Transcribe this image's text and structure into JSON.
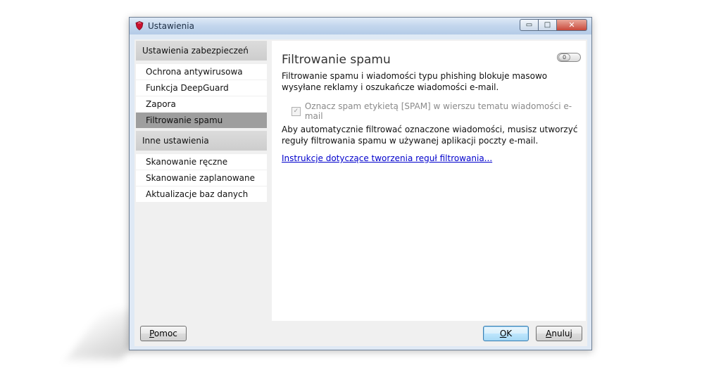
{
  "window": {
    "title": "Ustawienia"
  },
  "sidebar": {
    "sections": [
      {
        "header": "Ustawienia zabezpieczeń",
        "items": [
          {
            "label": "Ochrona antywirusowa",
            "active": false
          },
          {
            "label": "Funkcja DeepGuard",
            "active": false
          },
          {
            "label": "Zapora",
            "active": false
          },
          {
            "label": "Filtrowanie spamu",
            "active": true
          }
        ]
      },
      {
        "header": "Inne ustawienia",
        "items": [
          {
            "label": "Skanowanie ręczne",
            "active": false
          },
          {
            "label": "Skanowanie zaplanowane",
            "active": false
          },
          {
            "label": "Aktualizacje baz danych",
            "active": false
          }
        ]
      }
    ]
  },
  "main": {
    "title": "Filtrowanie spamu",
    "toggle_label": "0",
    "description": "Filtrowanie spamu i wiadomości typu phishing blokuje masowo wysyłane reklamy i oszukańcze wiadomości e-mail.",
    "checkbox_label": "Oznacz spam etykietą [SPAM] w wierszu tematu wiadomości e-mail",
    "checkbox_checked": true,
    "checkbox_mark": "✓",
    "note": "Aby automatycznie filtrować oznaczone wiadomości, musisz utworzyć reguły filtrowania spamu w używanej aplikacji poczty e-mail.",
    "link_text": "Instrukcje dotyczące tworzenia reguł filtrowania..."
  },
  "buttons": {
    "help": "Pomoc",
    "ok": "OK",
    "cancel": "Anuluj"
  },
  "caption_buttons": {
    "minimize": "▭",
    "maximize": "□",
    "close": "✕"
  },
  "colors": {
    "active_item": "#9e9e9e",
    "link": "#0000cc",
    "titlebar": "#c3d6ed"
  }
}
